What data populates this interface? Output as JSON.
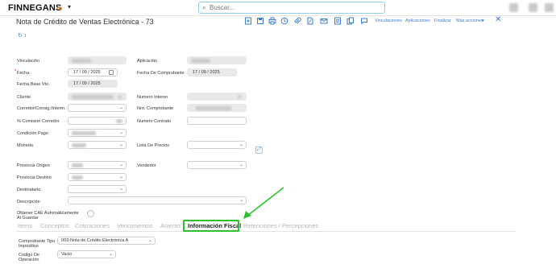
{
  "brand": {
    "name": "FINNEGANS",
    "loop": "∞",
    "caret": "▾"
  },
  "search": {
    "placeholder": "Buscar..."
  },
  "form": {
    "title": "Nota de Crédito de Ventas Electrónica - 73",
    "toolbar_links": [
      "Vinculaciones",
      "Aplicaciones",
      "Finalizar",
      "Más acciones"
    ],
    "labels": {
      "vinculacion": "Vinculación",
      "aplicacion": "Aplicación",
      "fecha": "Fecha",
      "fecha_required": "*",
      "fecha_comprobante": "Fecha De Comprobante",
      "fecha_base_vto": "Fecha Base Vto.",
      "cliente": "Cliente",
      "numero_interno": "Numero Interno",
      "corredor": "Corredor/Consig./Interm.",
      "nro_comprobante": "Nro. Comprobante",
      "comision_corredor": "% Comision Corredor",
      "numero_contrato": "Numero Contrato",
      "condicion_pago": "Condición Pago",
      "moneda": "Moneda",
      "lista_precios": "Lista De Precios",
      "provincia_origen": "Provincia Origen",
      "vendedor": "Vendedor",
      "provincia_destino": "Provincia Destino",
      "destinatario": "Destinatario",
      "descripcion": "Descripción",
      "obtener_cae": "Obtener CAE Automáticamente Al Guardar"
    },
    "values": {
      "fecha": "17 / 09 / 2025",
      "fecha_comprobante": "17 / 09 / 2025",
      "fecha_base_vto": "17 / 09 / 2025"
    }
  },
  "tabs": [
    {
      "label": "Items",
      "active": false
    },
    {
      "label": "Conceptos",
      "active": false
    },
    {
      "label": "Cotizaciones",
      "active": false
    },
    {
      "label": "Vencimientos",
      "active": false
    },
    {
      "label": "Asiento",
      "active": false
    },
    {
      "label": "Información Fiscal",
      "active": true
    },
    {
      "label": "Retenciones / Percepciones",
      "active": false
    }
  ],
  "fiscal": {
    "comprobante_tipo_label": "Comprobante Tipo Impositivo",
    "comprobante_tipo_value": "003-Nota de Crédito Electrónica A",
    "codigo_operacion_label": "Codigo De Operación",
    "codigo_operacion_value": "Vacio"
  },
  "colors": {
    "accent": "#3a7bd5",
    "highlight": "#2dc22d",
    "brand_loop": "#f08a24"
  },
  "icons": [
    "search-icon",
    "new-doc-icon",
    "save-icon",
    "print-icon",
    "history-icon",
    "attach-icon",
    "pdf-icon",
    "email-icon",
    "list-icon",
    "copy-icon",
    "comment-icon",
    "close-icon",
    "refresh-icon",
    "calendar-icon",
    "chevron-down-icon"
  ]
}
